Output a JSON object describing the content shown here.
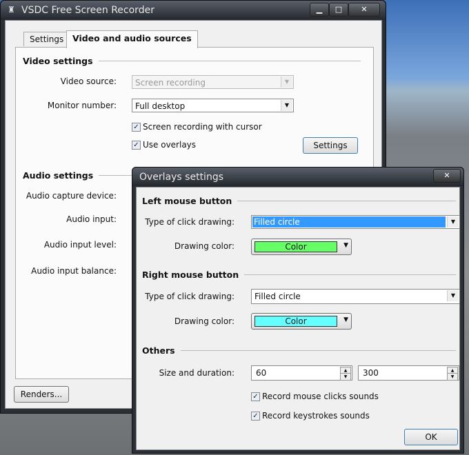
{
  "main_window": {
    "title": "VSDC Free Screen Recorder",
    "tabs": [
      {
        "label": "Settings"
      },
      {
        "label": "Video and audio sources"
      }
    ],
    "video_settings": {
      "header": "Video settings",
      "video_source_label": "Video source:",
      "video_source_value": "Screen recording",
      "monitor_label": "Monitor number:",
      "monitor_value": "Full desktop",
      "cursor_label": "Screen recording with cursor",
      "overlays_label": "Use overlays",
      "settings_button": "Settings"
    },
    "audio_settings": {
      "header": "Audio settings",
      "capture_label": "Audio capture device:",
      "input_label": "Audio input:",
      "level_label": "Audio input level:",
      "balance_label": "Audio input balance:"
    },
    "renders_button": "Renders..."
  },
  "overlays_dialog": {
    "title": "Overlays settings",
    "left": {
      "header": "Left mouse button",
      "type_label": "Type of click drawing:",
      "type_value": "Filled circle",
      "color_label": "Drawing color:",
      "color_button": "Color",
      "color": "#66ff66"
    },
    "right": {
      "header": "Right mouse button",
      "type_label": "Type of click drawing:",
      "type_value": "Filled circle",
      "color_label": "Drawing color:",
      "color_button": "Color",
      "color": "#66ffff"
    },
    "others": {
      "header": "Others",
      "size_label": "Size and duration:",
      "size_value": "60",
      "duration_value": "300",
      "clicks_sounds": "Record mouse clicks sounds",
      "keystrokes_sounds": "Record keystrokes sounds"
    },
    "ok_button": "OK"
  }
}
